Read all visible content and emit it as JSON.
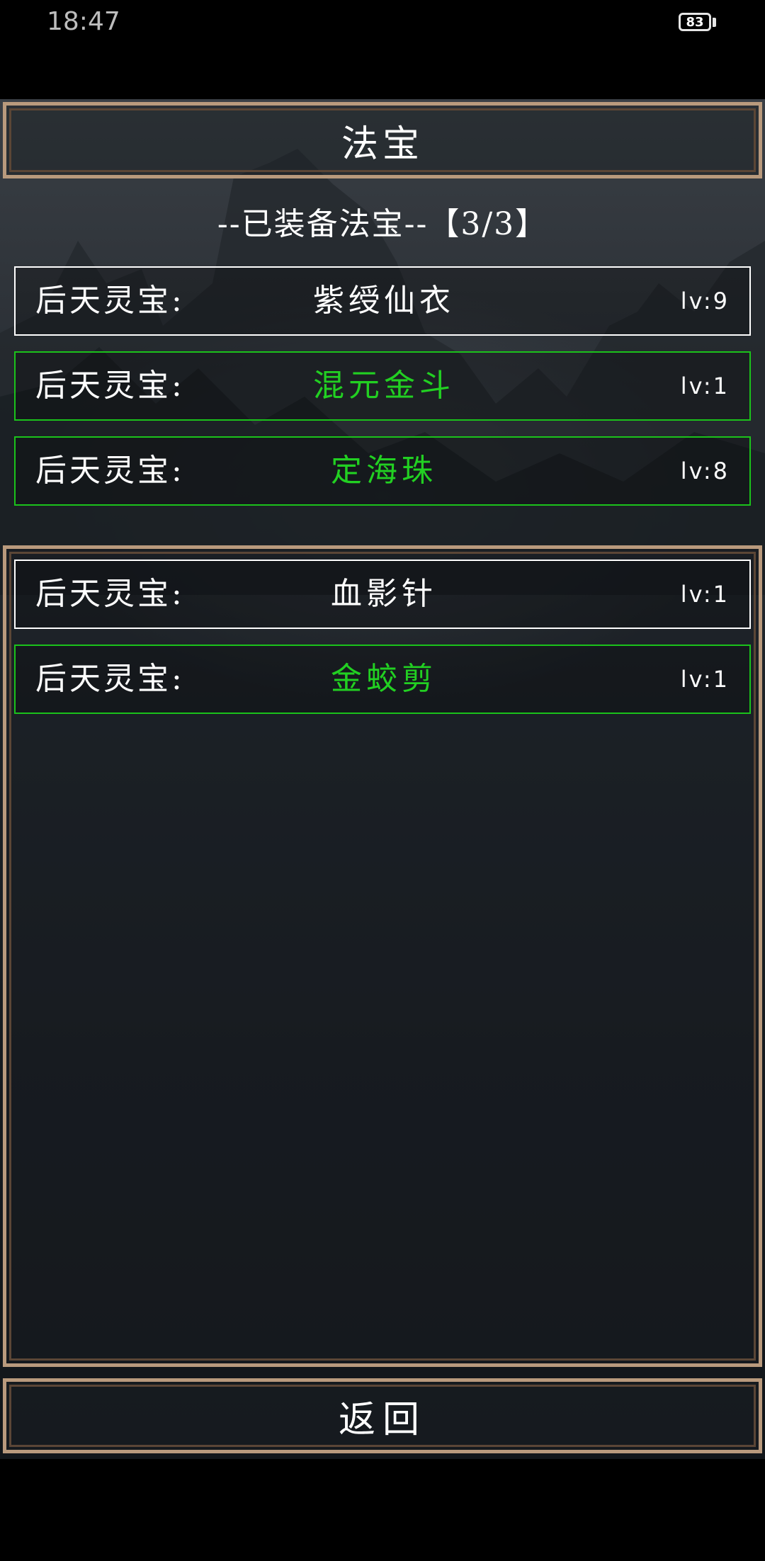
{
  "status": {
    "time": "18:47",
    "battery": "83"
  },
  "title": "法宝",
  "equipped_header": "--已装备法宝--【3/3】",
  "equipped": [
    {
      "type": "后天灵宝:",
      "name": "紫绶仙衣",
      "level": "lv:9",
      "color": "#ffffff"
    },
    {
      "type": "后天灵宝:",
      "name": "混元金斗",
      "level": "lv:1",
      "color": "#22d022"
    },
    {
      "type": "后天灵宝:",
      "name": "定海珠",
      "level": "lv:8",
      "color": "#22d022"
    }
  ],
  "inventory": [
    {
      "type": "后天灵宝:",
      "name": "血影针",
      "level": "lv:1",
      "color": "#ffffff"
    },
    {
      "type": "后天灵宝:",
      "name": "金蛟剪",
      "level": "lv:1",
      "color": "#22d022"
    }
  ],
  "back_label": "返回"
}
